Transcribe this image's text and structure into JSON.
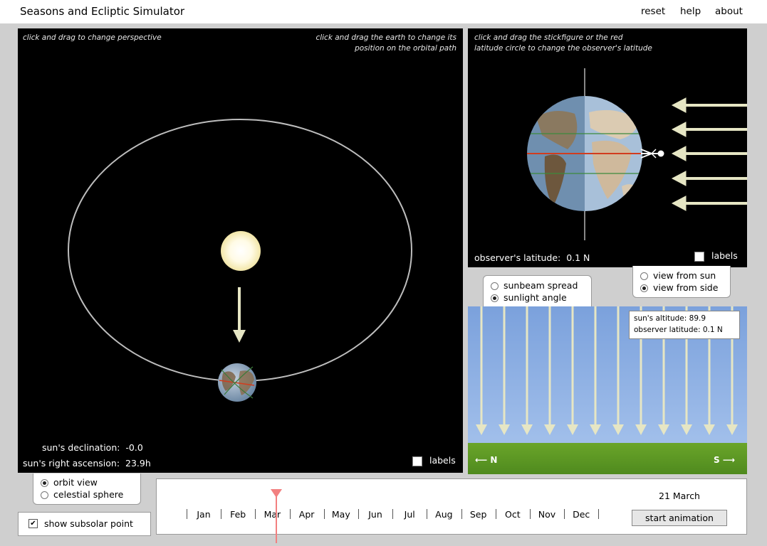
{
  "app": {
    "title": "Seasons and Ecliptic Simulator",
    "menu": {
      "reset": "reset",
      "help": "help",
      "about": "about"
    }
  },
  "orbit_panel": {
    "hint_left": "click and drag to change perspective",
    "hint_right_line1": "click and drag the earth to change its",
    "hint_right_line2": "position on the orbital path",
    "declination_label": "sun's declination:",
    "declination_value": "-0.0",
    "ra_label": "sun's right ascension:",
    "ra_value": "23.9h",
    "labels_checkbox": "labels",
    "labels_checked": false
  },
  "earth_panel": {
    "hint_line1": "click and drag the stickfigure or the red",
    "hint_line2": "latitude circle to change the observer's latitude",
    "latitude_label": "observer's latitude:",
    "latitude_value": "0.1 N",
    "labels_checkbox": "labels",
    "labels_checked": false
  },
  "view_options": {
    "view_from_sun": "view from sun",
    "view_from_side": "view from side",
    "selected": "view_from_side"
  },
  "sun_options": {
    "sunbeam_spread": "sunbeam spread",
    "sunlight_angle": "sunlight angle",
    "selected": "sunlight_angle"
  },
  "ground_panel": {
    "altitude_text": "sun's altitude: 89.9",
    "observer_text": "observer latitude: 0.1 N",
    "north_label": "N",
    "south_label": "S"
  },
  "perspective_options": {
    "orbit_view": "orbit view",
    "celestial_sphere": "celestial sphere",
    "selected": "orbit_view"
  },
  "subsolar": {
    "label": "show subsolar point",
    "checked": true
  },
  "timeline": {
    "months": [
      "Jan",
      "Feb",
      "Mar",
      "Apr",
      "May",
      "Jun",
      "Jul",
      "Aug",
      "Sep",
      "Oct",
      "Nov",
      "Dec"
    ],
    "date": "21 March",
    "start_button": "start animation"
  },
  "colors": {
    "sky": "#7ea4dc",
    "ground": "#6aa52a",
    "latitude_line": "#d23c1e",
    "sunbeam": "#e6e6c4",
    "slider_marker": "#f28080"
  }
}
